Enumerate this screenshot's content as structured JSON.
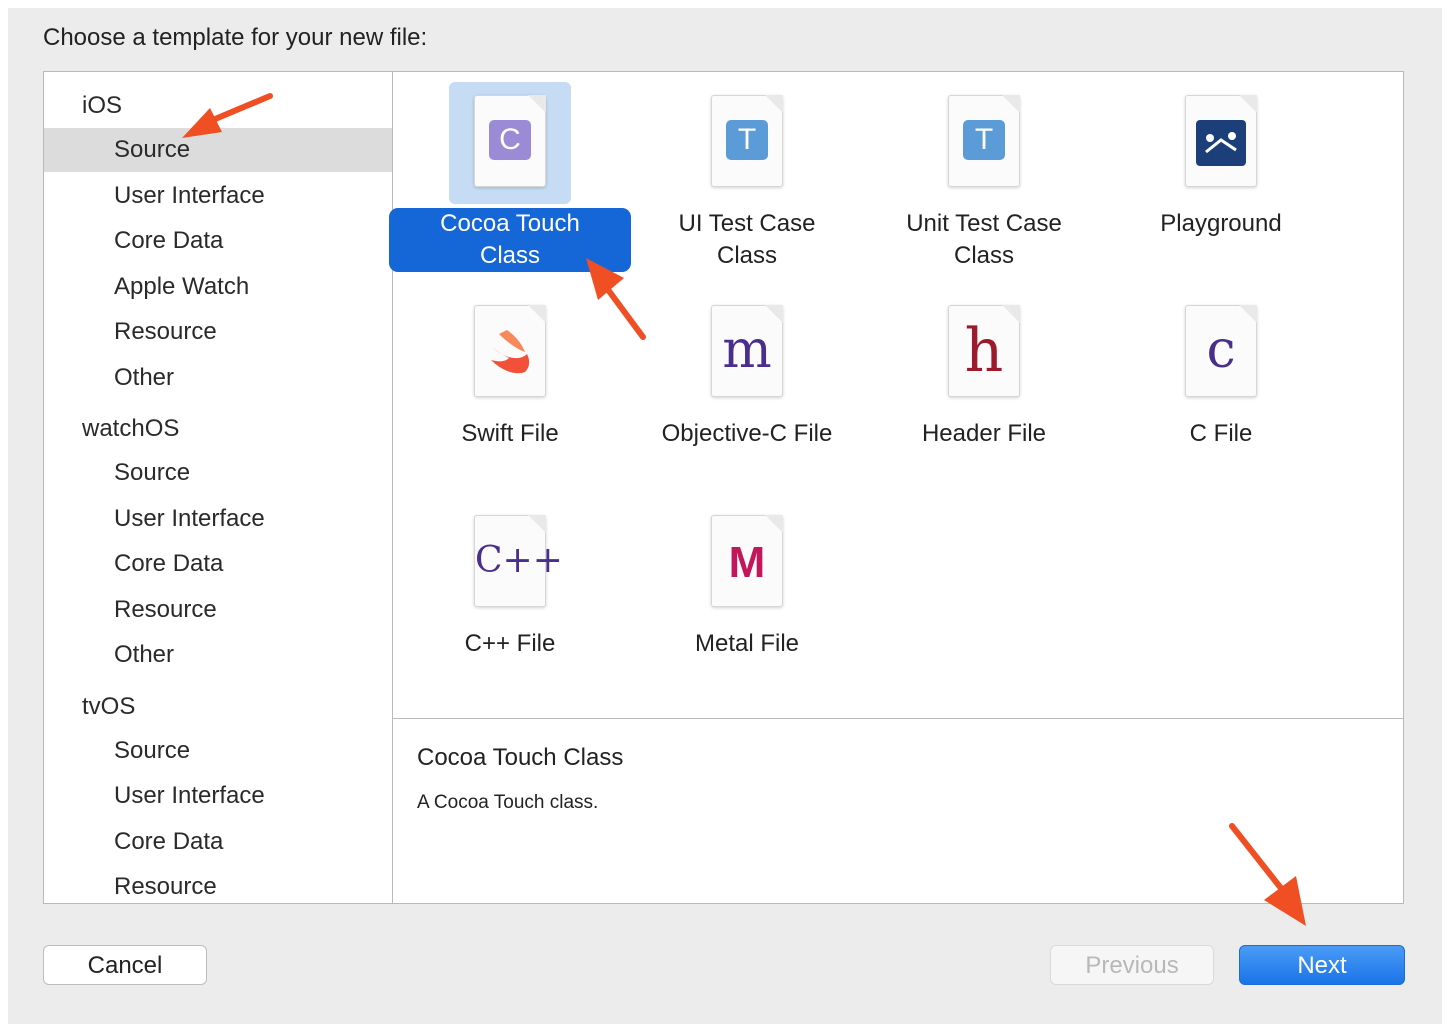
{
  "dialog": {
    "prompt": "Choose a template for your new file:"
  },
  "sidebar": {
    "rows": [
      {
        "label": "iOS",
        "kind": "group"
      },
      {
        "label": "Source",
        "kind": "item",
        "selected": true
      },
      {
        "label": "User Interface",
        "kind": "item"
      },
      {
        "label": "Core Data",
        "kind": "item"
      },
      {
        "label": "Apple Watch",
        "kind": "item"
      },
      {
        "label": "Resource",
        "kind": "item"
      },
      {
        "label": "Other",
        "kind": "item"
      },
      {
        "label": "watchOS",
        "kind": "group"
      },
      {
        "label": "Source",
        "kind": "item"
      },
      {
        "label": "User Interface",
        "kind": "item"
      },
      {
        "label": "Core Data",
        "kind": "item"
      },
      {
        "label": "Resource",
        "kind": "item"
      },
      {
        "label": "Other",
        "kind": "item"
      },
      {
        "label": "tvOS",
        "kind": "group"
      },
      {
        "label": "Source",
        "kind": "item"
      },
      {
        "label": "User Interface",
        "kind": "item"
      },
      {
        "label": "Core Data",
        "kind": "item"
      },
      {
        "label": "Resource",
        "kind": "item"
      }
    ]
  },
  "templates": [
    {
      "label": "Cocoa Touch Class",
      "line1": "Cocoa Touch",
      "line2": "Class",
      "icon": "cocoa-touch-class-icon",
      "glyph": "C",
      "selected": true
    },
    {
      "label": "UI Test Case Class",
      "line1": "UI Test Case",
      "line2": "Class",
      "icon": "ui-test-case-icon",
      "glyph": "T"
    },
    {
      "label": "Unit Test Case Class",
      "line1": "Unit Test Case",
      "line2": "Class",
      "icon": "unit-test-case-icon",
      "glyph": "T"
    },
    {
      "label": "Playground",
      "line1": "Playground",
      "line2": "",
      "icon": "playground-icon",
      "glyph": ""
    },
    {
      "label": "Swift File",
      "line1": "Swift File",
      "line2": "",
      "icon": "swift-file-icon",
      "glyph": ""
    },
    {
      "label": "Objective-C File",
      "line1": "Objective-C File",
      "line2": "",
      "icon": "objective-c-file-icon",
      "glyph": "m"
    },
    {
      "label": "Header File",
      "line1": "Header File",
      "line2": "",
      "icon": "header-file-icon",
      "glyph": "h"
    },
    {
      "label": "C File",
      "line1": "C File",
      "line2": "",
      "icon": "c-file-icon",
      "glyph": "c"
    },
    {
      "label": "C++ File",
      "line1": "C++ File",
      "line2": "",
      "icon": "cpp-file-icon",
      "glyph": "C++"
    },
    {
      "label": "Metal File",
      "line1": "Metal File",
      "line2": "",
      "icon": "metal-file-icon",
      "glyph": "M"
    }
  ],
  "description": {
    "title": "Cocoa Touch Class",
    "text": "A Cocoa Touch class."
  },
  "buttons": {
    "cancel": "Cancel",
    "previous": "Previous",
    "next": "Next"
  },
  "colors": {
    "accent": "#1566d7",
    "annotation_arrow": "#f04e23",
    "selection_bg": "#c5dcf4",
    "sidebar_selection": "#dcdcdc"
  }
}
